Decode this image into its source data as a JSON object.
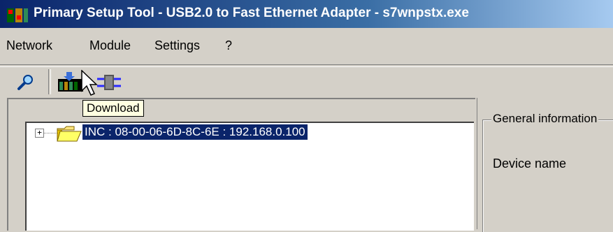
{
  "window": {
    "title": "Primary Setup Tool - USB2.0 to Fast Ethernet Adapter - s7wnpstx.exe",
    "icon": "app-icon"
  },
  "menu": {
    "items": [
      {
        "label": "Network"
      },
      {
        "label": "Module"
      },
      {
        "label": "Settings"
      },
      {
        "label": "?"
      }
    ]
  },
  "toolbar": {
    "buttons": [
      {
        "icon": "search-icon"
      },
      {
        "icon": "download-icon"
      },
      {
        "icon": "network-adapter-icon"
      }
    ],
    "tooltip": "Download"
  },
  "tree": {
    "items": [
      {
        "label": "INC : 08-00-06-6D-8C-6E : 192.168.0.100",
        "expander": "+",
        "icon": "folder-icon",
        "selected": true
      }
    ]
  },
  "details": {
    "group_title": "General information",
    "device_name_label": "Device name"
  },
  "colors": {
    "title_bar": "#0a246a",
    "selection": "#0a246a",
    "window_bg": "#d4d0c8",
    "tooltip_bg": "#ffffe1"
  }
}
